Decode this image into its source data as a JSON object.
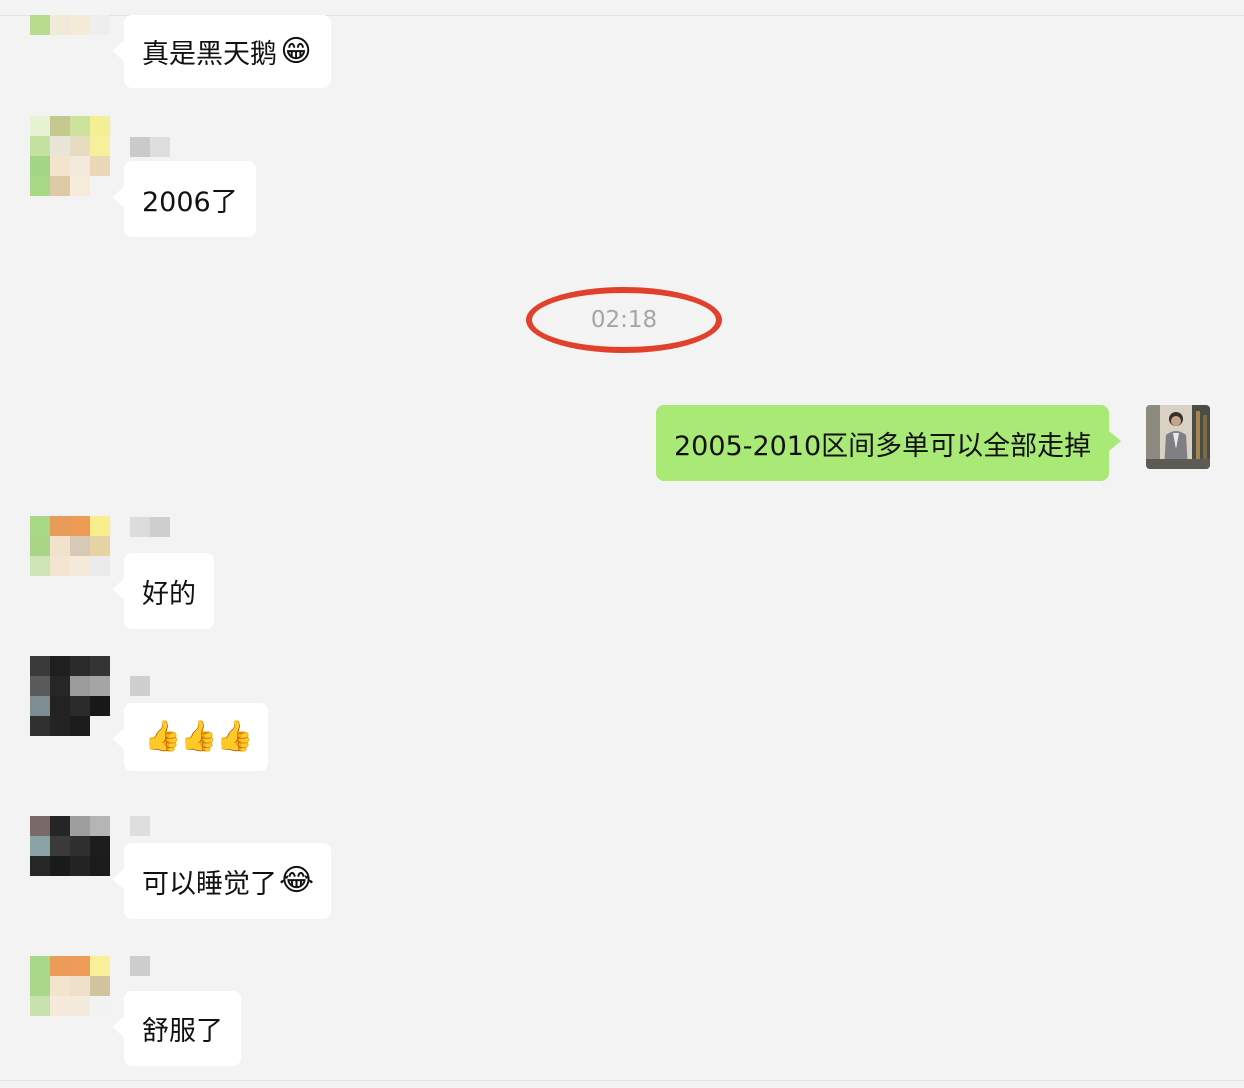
{
  "colors": {
    "background": "#f3f3f3",
    "bubble_other": "#ffffff",
    "bubble_self": "#a9e976",
    "timestamp_text": "#a5a5a5",
    "annotation_circle": "#e0402c"
  },
  "timestamp": "02:18",
  "messages": [
    {
      "sender": "other",
      "text": "真是黑天鹅",
      "emoji": "grinning-face-icon"
    },
    {
      "sender": "other",
      "text": "2006了"
    },
    {
      "sender": "self",
      "text": "2005-2010区间多单可以全部走掉"
    },
    {
      "sender": "other",
      "text": "好的"
    },
    {
      "sender": "other",
      "text": "",
      "emoji": "thumbs-up-icon x3"
    },
    {
      "sender": "other",
      "text": "可以睡觉了",
      "emoji": "tears-of-joy-icon"
    },
    {
      "sender": "other",
      "text": "舒服了"
    }
  ]
}
